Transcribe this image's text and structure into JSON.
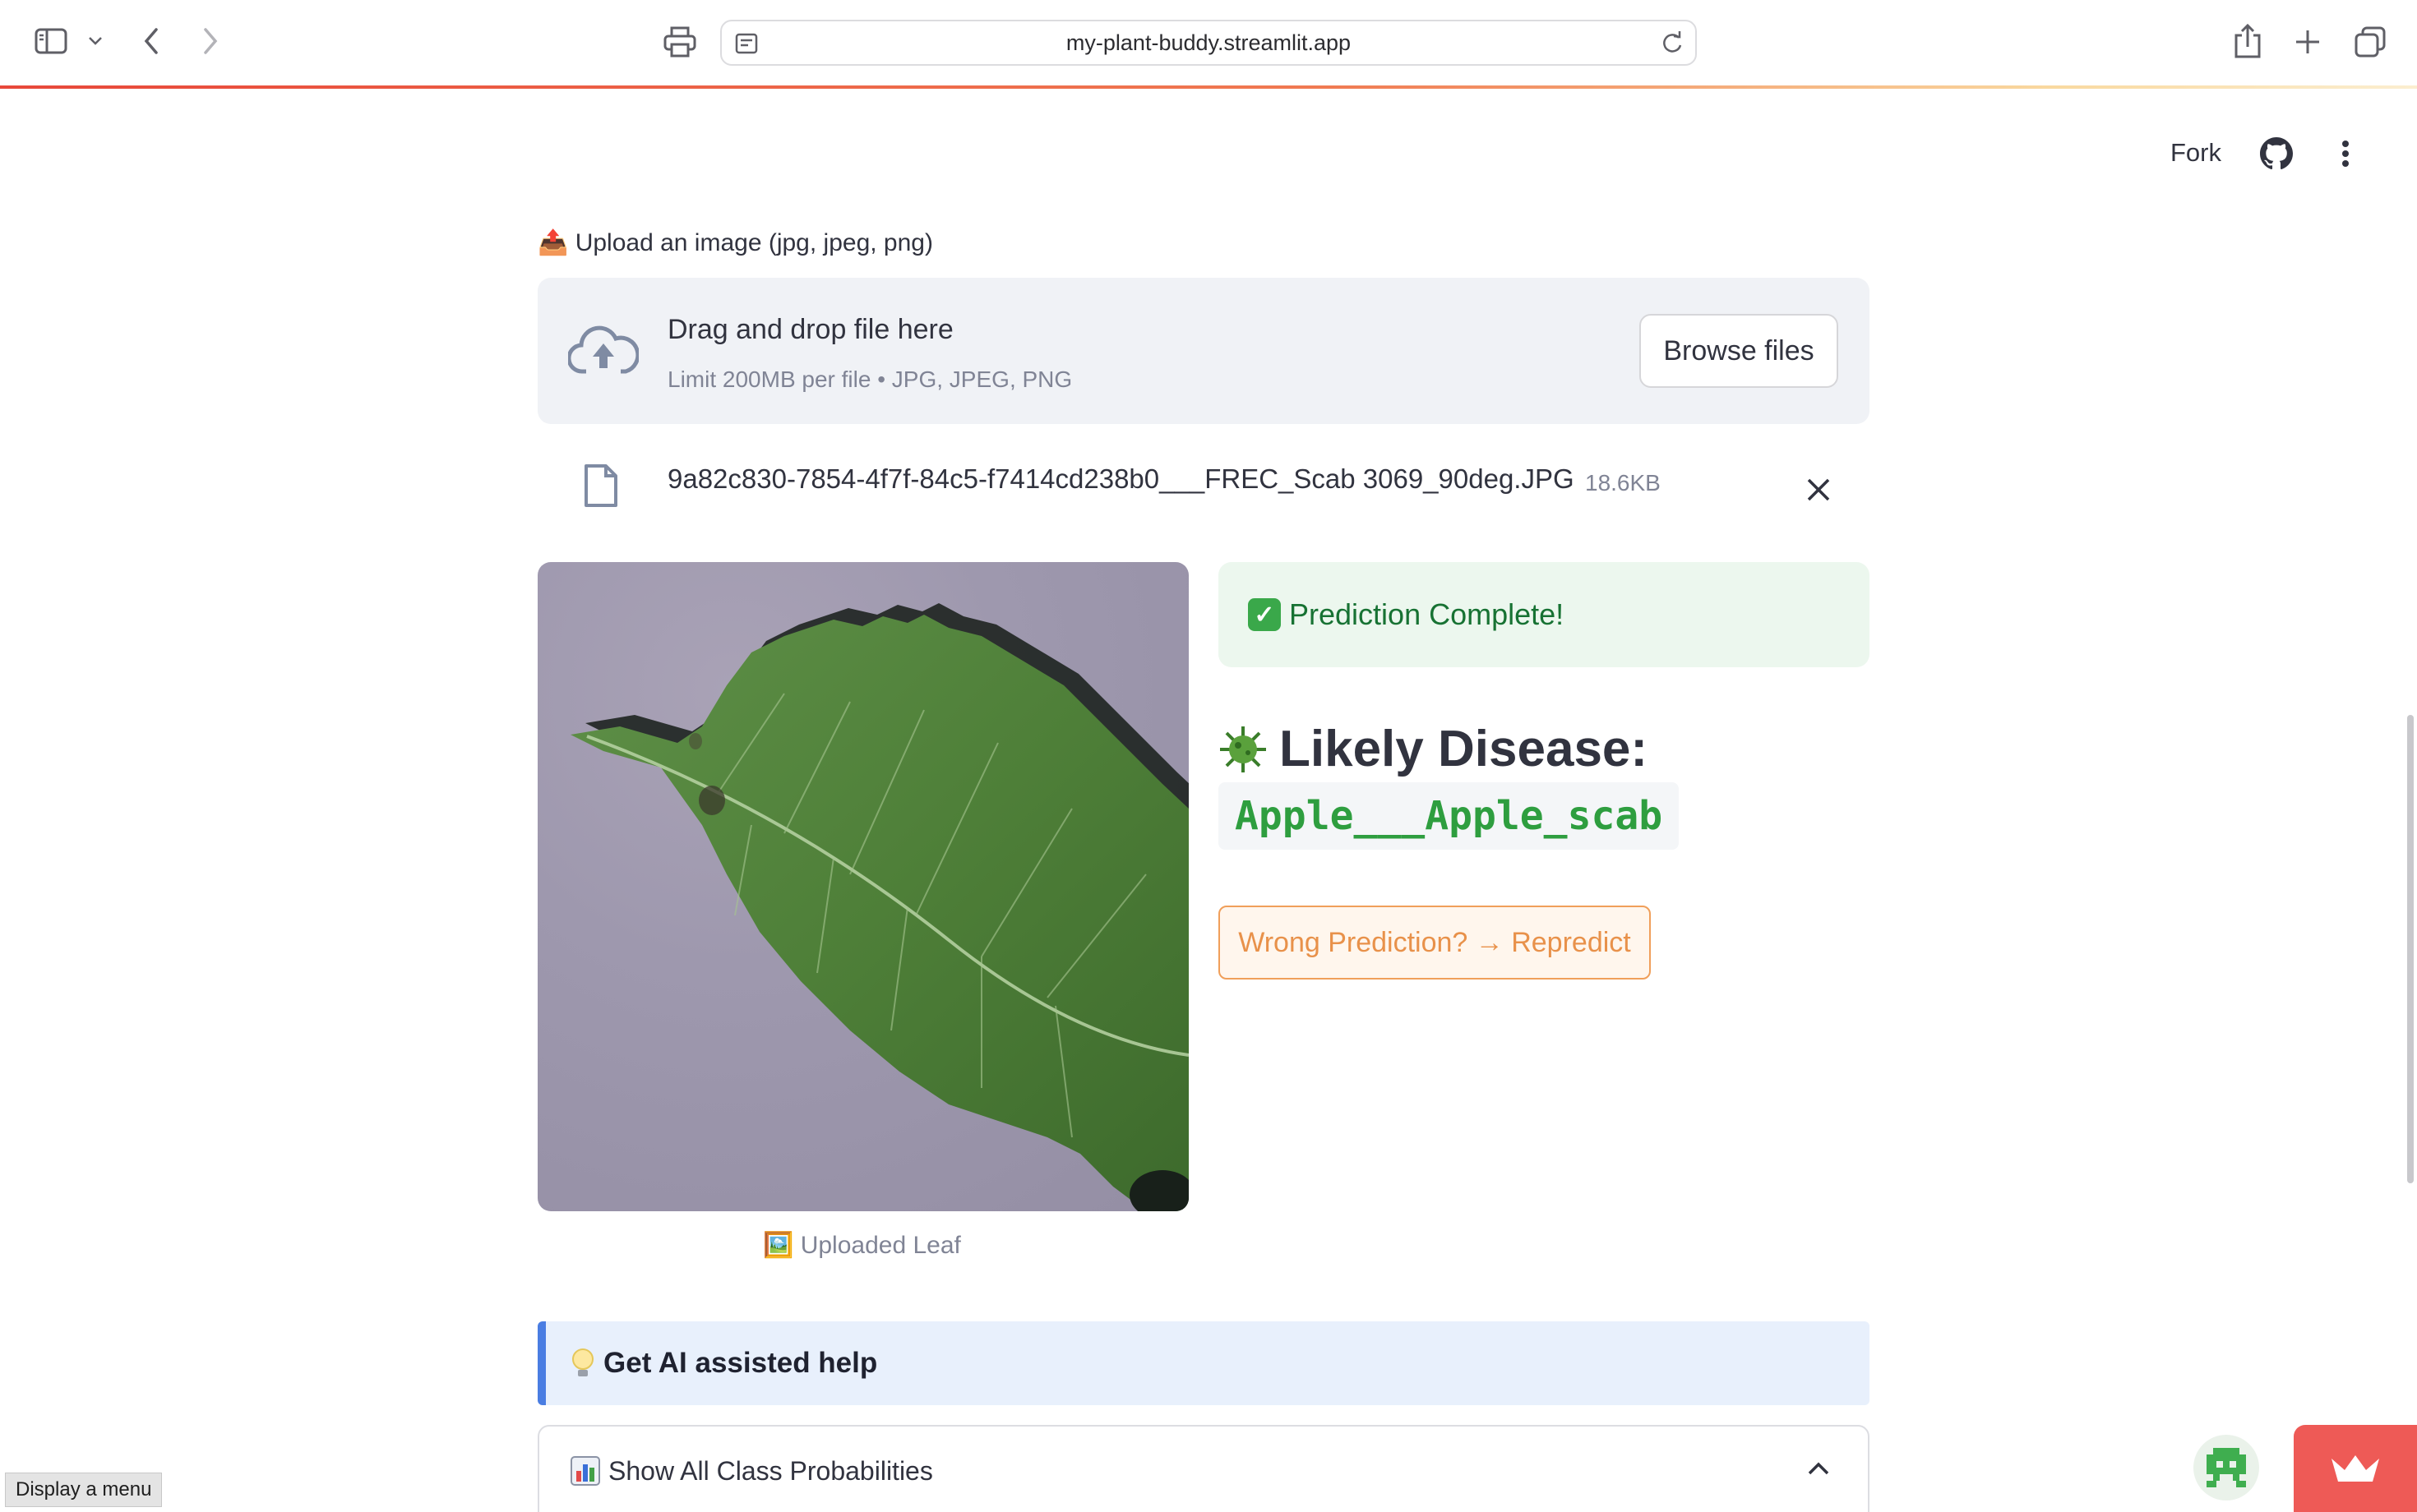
{
  "browser": {
    "url": "my-plant-buddy.streamlit.app",
    "tooltip": "Display a menu"
  },
  "header": {
    "fork_label": "Fork"
  },
  "uploader": {
    "label": "📤 Upload an image (jpg, jpeg, png)",
    "drop_title": "Drag and drop file here",
    "drop_subtitle": "Limit 200MB per file • JPG, JPEG, PNG",
    "browse_label": "Browse files",
    "file_name": "9a82c830-7854-4f7f-84c5-f7414cd238b0___FREC_Scab 3069_90deg.JPG",
    "file_size": "18.6KB"
  },
  "image": {
    "caption": "🖼️ Uploaded Leaf"
  },
  "result": {
    "success_text": "Prediction Complete!",
    "disease_heading": "Likely Disease:",
    "disease_code": "Apple___Apple_scab",
    "repredict_label": "Wrong Prediction? → Repredict"
  },
  "help": {
    "ai_label": "Get AI assisted help",
    "probabilities_label": "Show All Class Probabilities"
  },
  "icons": {
    "sidebar": "sidebar-toggle-icon",
    "back": "chevron-left-icon",
    "forward": "chevron-right-icon",
    "print": "printer-icon",
    "share": "share-icon",
    "new_tab": "plus-icon",
    "tabs": "tabs-overview-icon",
    "github": "github-icon",
    "more": "kebab-menu-icon",
    "upload": "cloud-upload-icon",
    "file": "file-icon",
    "close": "close-icon",
    "virus": "microbe-icon",
    "bulb": "light-bulb-icon",
    "chart": "bar-chart-icon",
    "chevron_up": "chevron-up-icon"
  },
  "colors": {
    "accent_red": "#ee5a56",
    "success_green": "#177233",
    "code_green": "#2e9e3f",
    "repredict_orange": "#e8914a",
    "info_blue": "#4a7de2"
  }
}
